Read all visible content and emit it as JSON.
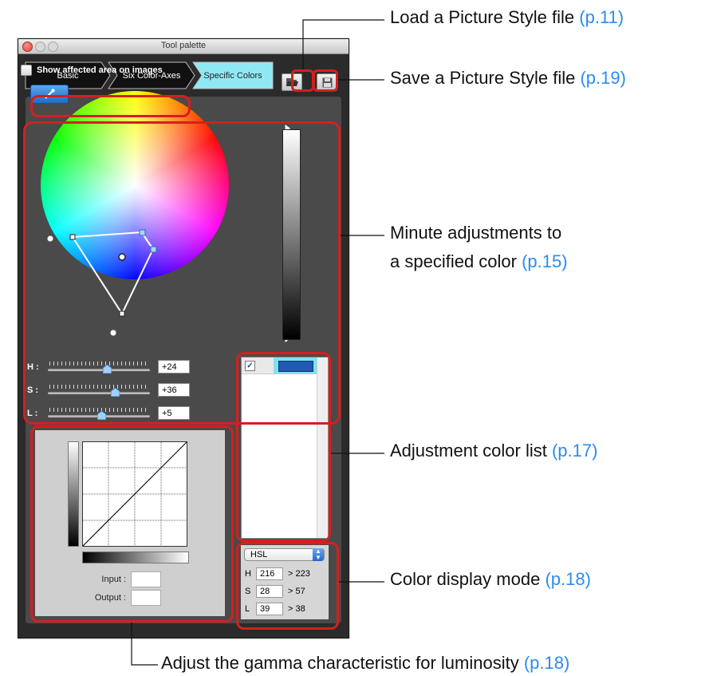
{
  "window": {
    "title": "Tool palette"
  },
  "tabs": [
    {
      "label": "Basic"
    },
    {
      "label": "Six Color-Axes"
    },
    {
      "label": "Specific Colors"
    }
  ],
  "toolbar": {
    "load_icon": "folder-open-icon",
    "save_icon": "floppy-disk-icon"
  },
  "checkbox": {
    "label": "Show affected area on images",
    "checked": false
  },
  "sliders": [
    {
      "label": "H :",
      "value": "+24",
      "position": 0.58
    },
    {
      "label": "S :",
      "value": "+36",
      "position": 0.66
    },
    {
      "label": "L :",
      "value": "+5",
      "position": 0.52
    }
  ],
  "gamma": {
    "input_label": "Input :",
    "output_label": "Output :",
    "input_value": "",
    "output_value": ""
  },
  "color_list": {
    "items": [
      {
        "checked": true,
        "swatch": "#1f5bb0"
      }
    ]
  },
  "color_mode": {
    "selected": "HSL",
    "rows": [
      {
        "key": "H",
        "value": "216",
        "new": "> 223"
      },
      {
        "key": "S",
        "value": "28",
        "new": "> 57"
      },
      {
        "key": "L",
        "value": "39",
        "new": "> 38"
      }
    ]
  },
  "callouts": {
    "load": {
      "text": "Load a Picture Style file",
      "ref": "(p.11)"
    },
    "save": {
      "text": "Save a Picture Style file",
      "ref": "(p.19)"
    },
    "minute_1": {
      "text": "Minute adjustments to"
    },
    "minute_2": {
      "text": "a specified color",
      "ref": "(p.15)"
    },
    "list": {
      "text": "Adjustment color list",
      "ref": "(p.17)"
    },
    "mode": {
      "text": "Color display mode",
      "ref": "(p.18)"
    },
    "gamma": {
      "text": "Adjust the gamma characteristic for luminosity",
      "ref": "(p.18)"
    }
  },
  "colors": {
    "highlight": "#d41f1f",
    "reference": "#2a8cf0",
    "active_tab": "#8fe9f5"
  }
}
